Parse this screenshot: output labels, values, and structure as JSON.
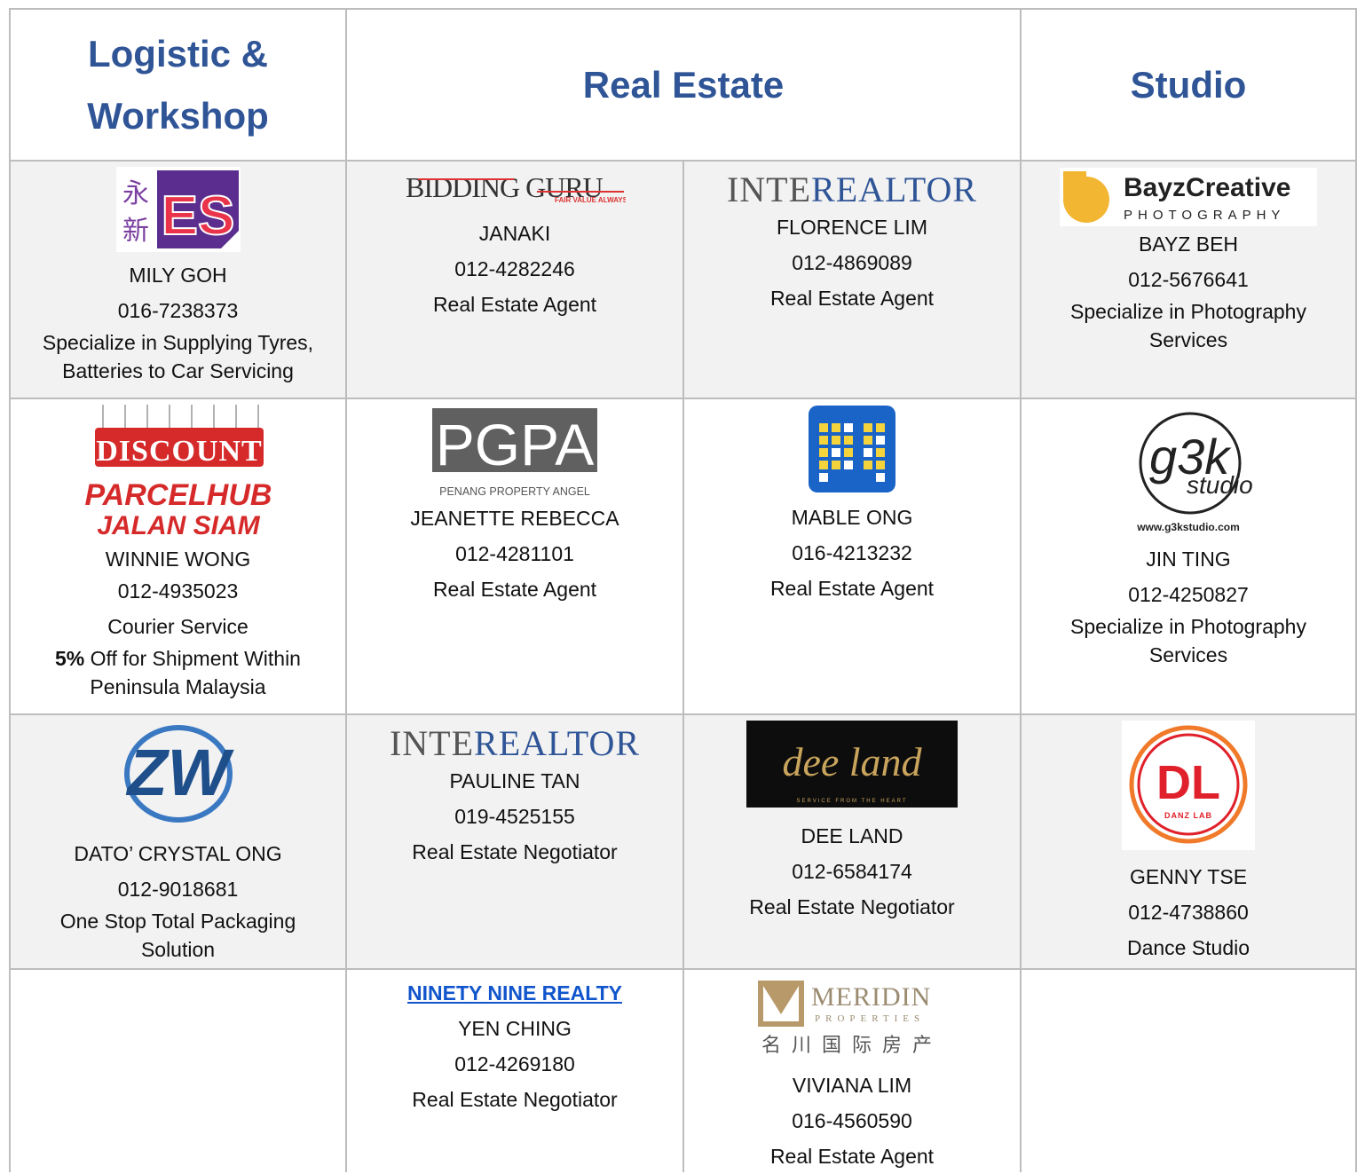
{
  "headers": {
    "logistic": "Logistic &\nWorkshop",
    "real_estate": "Real Estate",
    "studio": "Studio"
  },
  "logos": {
    "yongxin": {
      "cn_top": "永",
      "cn_bottom": "新",
      "mark": "ES"
    },
    "bidding_guru": {
      "name": "BIDDING GURU",
      "tagline": "FAIR VALUE ALWAYS"
    },
    "interealtor": {
      "part1": "INTE",
      "part2": "REALTOR"
    },
    "bayz": {
      "name": "BayzCreative",
      "sub": "PHOTOGRAPHY"
    },
    "discount": {
      "tags": "DISCOUNT",
      "line1": "PARCELHUB",
      "line2": "JALAN SIAM"
    },
    "pgpa": {
      "mark": "PGPA",
      "sub": "PENANG PROPERTY ANGEL"
    },
    "g3k": {
      "mark": "g3k",
      "word": "studio",
      "url": "www.g3kstudio.com"
    },
    "zw": {
      "mark": "ZW"
    },
    "deeland": {
      "script": "dee land",
      "sub": "SERVICE FROM THE HEART"
    },
    "danzlab": {
      "mark": "DL",
      "sub": "DANZ LAB"
    },
    "meridin": {
      "name": "MERIDIN",
      "sub": "PROPERTIES",
      "cn": "名川国际房产"
    }
  },
  "rows": [
    [
      {
        "name": "MILY GOH",
        "phone": "016-7238373",
        "desc": "Specialize in Supplying Tyres, Batteries to Car Servicing"
      },
      {
        "name": "JANAKI",
        "phone": "012-4282246",
        "desc": "Real Estate Agent"
      },
      {
        "name": "FLORENCE LIM",
        "phone": "012-4869089",
        "desc": "Real Estate Agent"
      },
      {
        "name": "BAYZ BEH",
        "phone": "012-5676641",
        "desc": "Specialize in Photography Services"
      }
    ],
    [
      {
        "name": "WINNIE WONG",
        "phone": "012-4935023",
        "desc": "Courier Service",
        "promo_bold": "5%",
        "promo_rest": " Off for Shipment Within Peninsula Malaysia"
      },
      {
        "name": "JEANETTE REBECCA",
        "phone": "012-4281101",
        "desc": "Real Estate Agent"
      },
      {
        "name": "MABLE ONG",
        "phone": "016-4213232",
        "desc": "Real Estate Agent"
      },
      {
        "name": "JIN TING",
        "phone": "012-4250827",
        "desc": "Specialize in Photography Services"
      }
    ],
    [
      {
        "name": "DATO’ CRYSTAL ONG",
        "phone": "012-9018681",
        "desc": "One Stop Total Packaging Solution"
      },
      {
        "name": "PAULINE TAN",
        "phone": "019-4525155",
        "desc": "Real Estate Negotiator"
      },
      {
        "name": "DEE LAND",
        "phone": "012-6584174",
        "desc": "Real Estate Negotiator"
      },
      {
        "name": "GENNY TSE",
        "phone": "012-4738860",
        "desc": "Dance Studio"
      }
    ],
    [
      null,
      {
        "link": "NINETY NINE REALTY",
        "name": "YEN CHING",
        "phone": "012-4269180",
        "desc": "Real Estate Negotiator"
      },
      {
        "name": "VIVIANA LIM",
        "phone": "016-4560590",
        "desc": "Real Estate Agent"
      },
      null
    ]
  ]
}
